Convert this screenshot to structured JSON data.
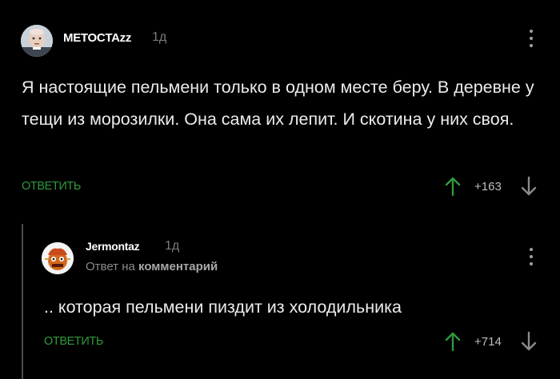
{
  "colors": {
    "background": "#000000",
    "accent_green": "#2f9a3d",
    "text": "#ececec",
    "muted": "#7a7a7a"
  },
  "comments": [
    {
      "username": "METOCTAzz",
      "time": "1д",
      "text": "Я настоящие пельмени только в одном месте беру. В деревне у тещи из морозилки. Она сама их лепит. И скотина у них своя.",
      "reply_label": "ОТВЕТИТЬ",
      "score": "+163",
      "icons": {
        "avatar": "avatar-photo",
        "more": "more-vertical-icon",
        "up": "arrow-up-icon",
        "down": "arrow-down-icon"
      }
    },
    {
      "username": "Jermontaz",
      "time": "1д",
      "reply_to_prefix": "Ответ на",
      "reply_to_target": "комментарий",
      "text": ".. которая пельмени пиздит из холодильника",
      "reply_label": "ОТВЕТИТЬ",
      "score": "+714",
      "icons": {
        "avatar": "avatar-cartoon",
        "more": "more-vertical-icon",
        "up": "arrow-up-icon",
        "down": "arrow-down-icon"
      }
    }
  ]
}
